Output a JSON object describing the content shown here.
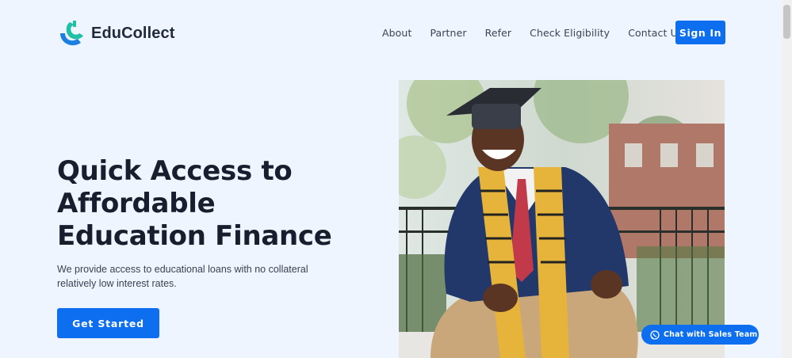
{
  "brand": {
    "name": "EduCollect",
    "accent": "#0d6ef0",
    "logo_colors": [
      "#1fc0a6",
      "#1a7fe0"
    ]
  },
  "nav": {
    "items": [
      {
        "label": "About"
      },
      {
        "label": "Partner"
      },
      {
        "label": "Refer"
      },
      {
        "label": "Check Eligibility"
      },
      {
        "label": "Contact Us"
      }
    ],
    "signin_label": "Sign In"
  },
  "hero": {
    "title_lines": [
      "Quick Access to",
      "Affordable",
      "Education Finance"
    ],
    "subtitle": "We provide access to educational loans with no collateral relatively low interest rates.",
    "cta_label": "Get Started",
    "image_icon": "graduate-photo"
  },
  "chat": {
    "label": "Chat with Sales Team",
    "icon": "whatsapp-icon"
  }
}
